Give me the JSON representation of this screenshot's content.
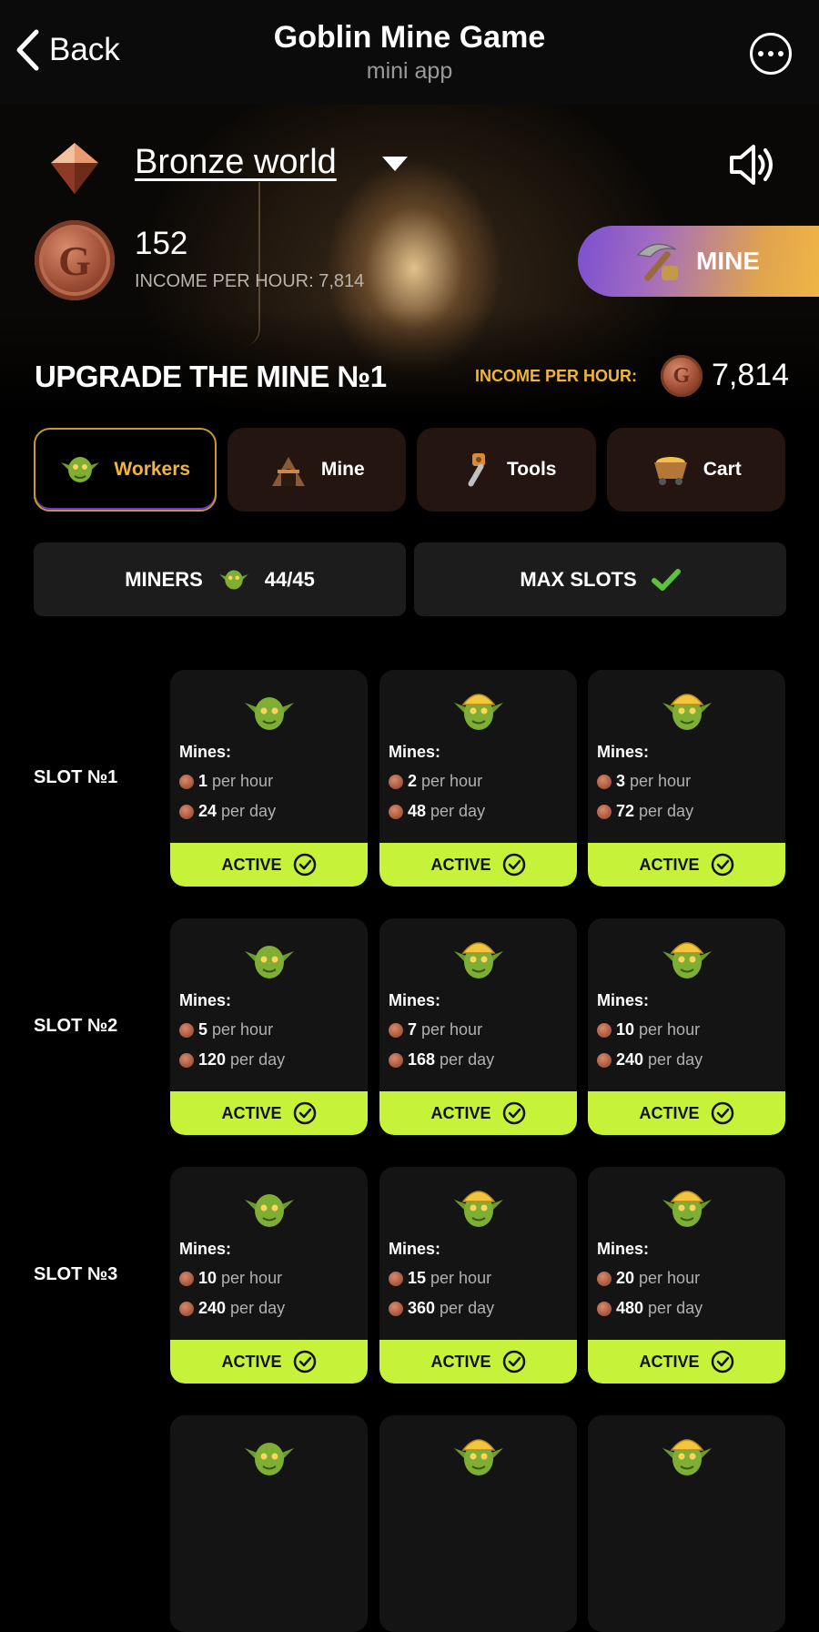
{
  "header": {
    "back_label": "Back",
    "title": "Goblin Mine Game",
    "subtitle": "mini app"
  },
  "hero": {
    "world_name": "Bronze world",
    "balance": "152",
    "income_text": "INCOME PER HOUR:  7,814",
    "mine_button": "MINE",
    "upgrade_title": "UPGRADE THE MINE №1",
    "income_label": "INCOME PER HOUR:",
    "income_value": "7,814"
  },
  "tabs": [
    {
      "label": "Workers",
      "active": true
    },
    {
      "label": "Mine",
      "active": false
    },
    {
      "label": "Tools",
      "active": false
    },
    {
      "label": "Cart",
      "active": false
    }
  ],
  "stats": {
    "miners_label": "MINERS",
    "miners_value": "44/45",
    "max_slots_label": "MAX SLOTS"
  },
  "slots": [
    {
      "label": "SLOT №1",
      "cards": [
        {
          "mines_label": "Mines:",
          "per_hour": "1",
          "per_hour_unit": "per hour",
          "per_day": "24",
          "per_day_unit": "per day",
          "status": "ACTIVE"
        },
        {
          "mines_label": "Mines:",
          "per_hour": "2",
          "per_hour_unit": "per hour",
          "per_day": "48",
          "per_day_unit": "per day",
          "status": "ACTIVE"
        },
        {
          "mines_label": "Mines:",
          "per_hour": "3",
          "per_hour_unit": "per hour",
          "per_day": "72",
          "per_day_unit": "per day",
          "status": "ACTIVE"
        }
      ]
    },
    {
      "label": "SLOT №2",
      "cards": [
        {
          "mines_label": "Mines:",
          "per_hour": "5",
          "per_hour_unit": "per hour",
          "per_day": "120",
          "per_day_unit": "per day",
          "status": "ACTIVE"
        },
        {
          "mines_label": "Mines:",
          "per_hour": "7",
          "per_hour_unit": "per hour",
          "per_day": "168",
          "per_day_unit": "per day",
          "status": "ACTIVE"
        },
        {
          "mines_label": "Mines:",
          "per_hour": "10",
          "per_hour_unit": "per hour",
          "per_day": "240",
          "per_day_unit": "per day",
          "status": "ACTIVE"
        }
      ]
    },
    {
      "label": "SLOT №3",
      "cards": [
        {
          "mines_label": "Mines:",
          "per_hour": "10",
          "per_hour_unit": "per hour",
          "per_day": "240",
          "per_day_unit": "per day",
          "status": "ACTIVE"
        },
        {
          "mines_label": "Mines:",
          "per_hour": "15",
          "per_hour_unit": "per hour",
          "per_day": "360",
          "per_day_unit": "per day",
          "status": "ACTIVE"
        },
        {
          "mines_label": "Mines:",
          "per_hour": "20",
          "per_hour_unit": "per hour",
          "per_day": "480",
          "per_day_unit": "per day",
          "status": "ACTIVE"
        }
      ]
    }
  ],
  "colors": {
    "active_green": "#c7f23a",
    "gold": "#f0b53a",
    "coin_bronze": "#9a4a32",
    "tab_bg": "#241510"
  },
  "icons": [
    "chevron-left-icon",
    "more-icon",
    "gem-icon",
    "caret-down-icon",
    "speaker-icon",
    "coin-icon",
    "pickaxe-icon",
    "goblin-icon",
    "mine-cart-icon",
    "tools-icon",
    "checkmark-icon",
    "check-circle-icon"
  ]
}
